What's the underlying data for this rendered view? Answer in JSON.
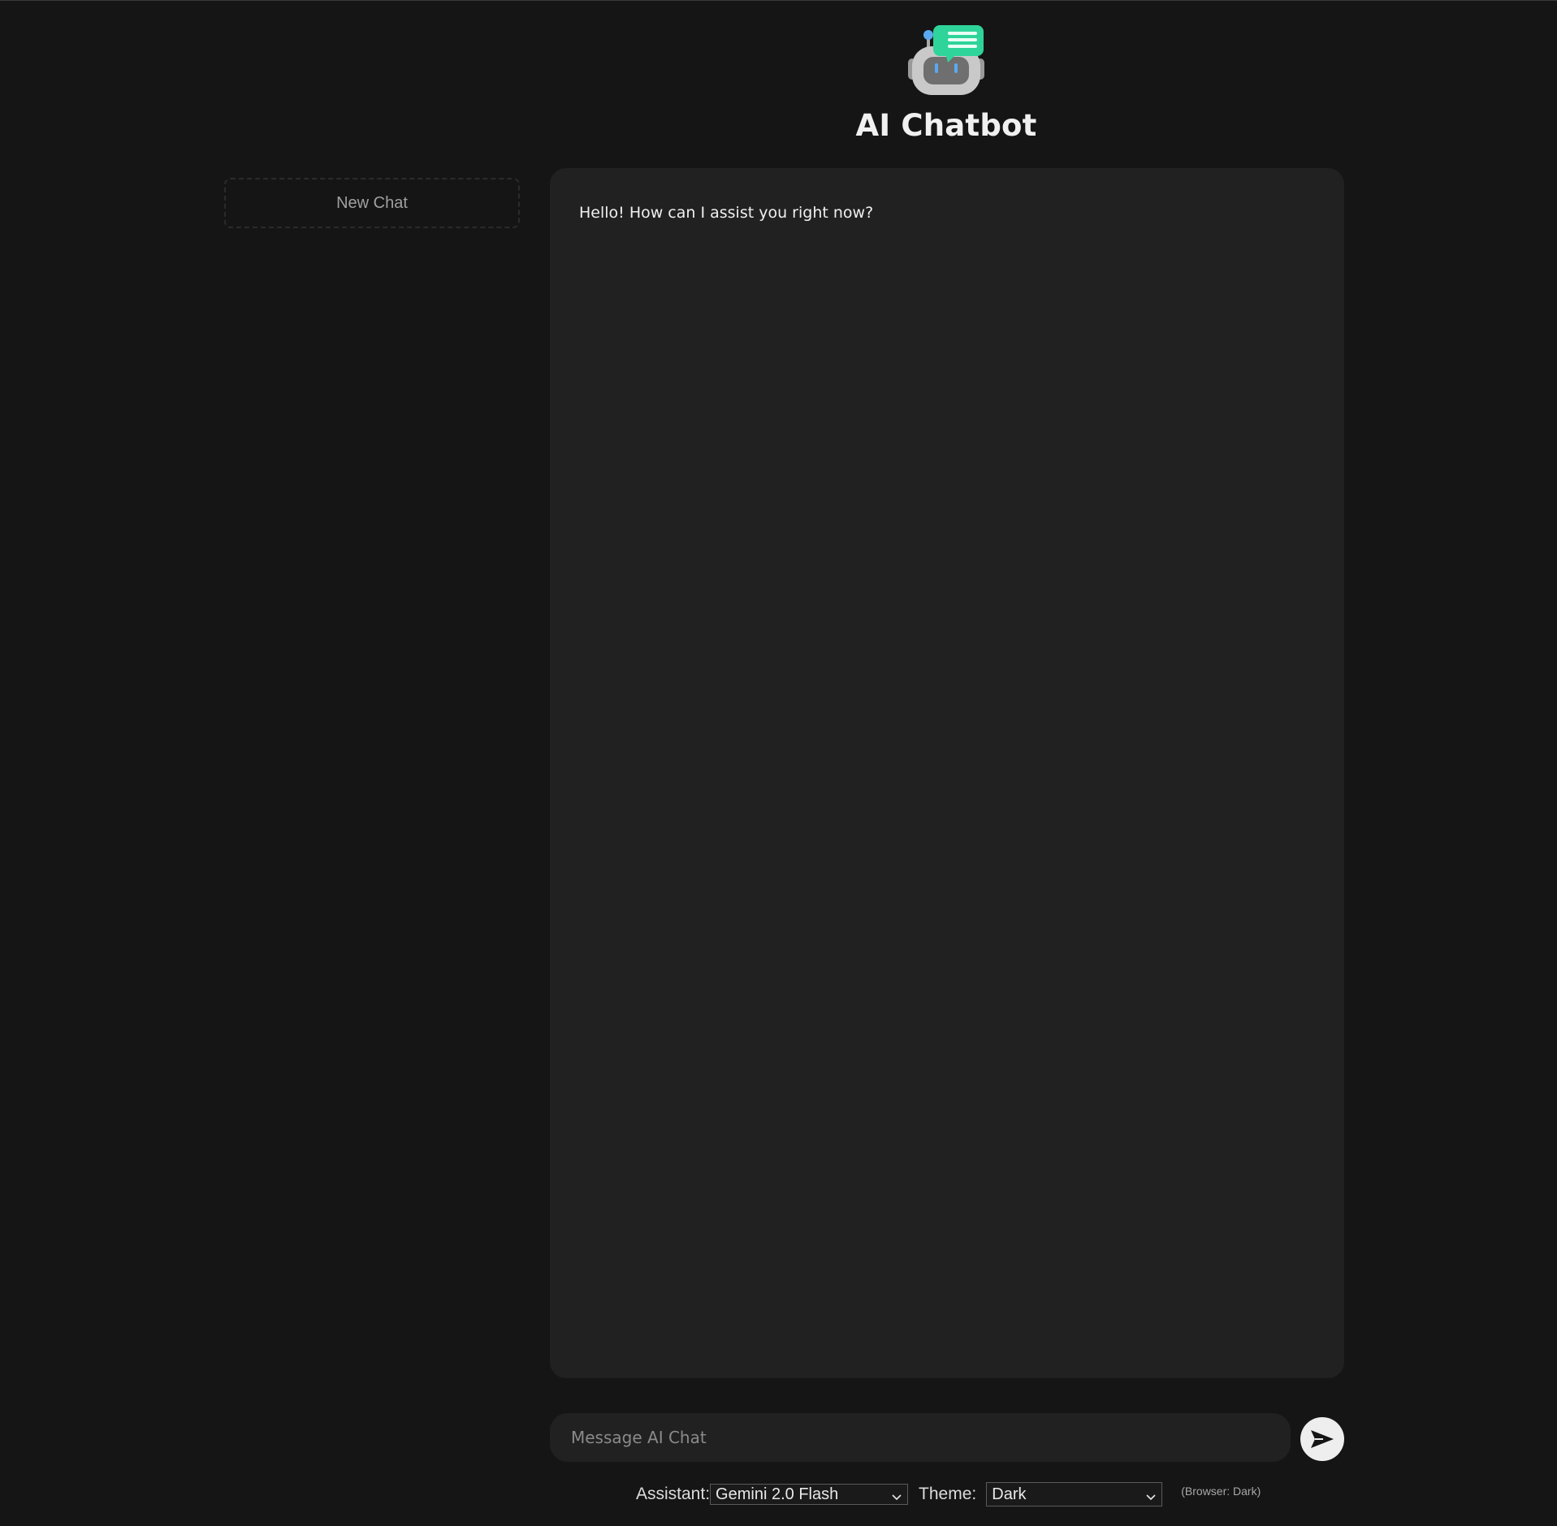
{
  "header": {
    "logo_icon": "robot-chat-icon",
    "title": "AI Chatbot"
  },
  "sidebar": {
    "new_chat_label": "New Chat"
  },
  "chat": {
    "messages": [
      {
        "role": "assistant",
        "text": "Hello! How can I assist you right now?"
      }
    ]
  },
  "composer": {
    "placeholder": "Message AI Chat",
    "value": "",
    "send_icon": "send-arrow-icon"
  },
  "controls": {
    "assistant_label": "Assistant:",
    "assistant_value": "Gemini 2.0 Flash",
    "theme_label": "Theme:",
    "theme_value": "Dark",
    "browser_note": "(Browser: Dark)"
  },
  "colors": {
    "background": "#151515",
    "panel": "#212121",
    "accent_green": "#2fd49a",
    "accent_blue": "#5aa9f0"
  }
}
